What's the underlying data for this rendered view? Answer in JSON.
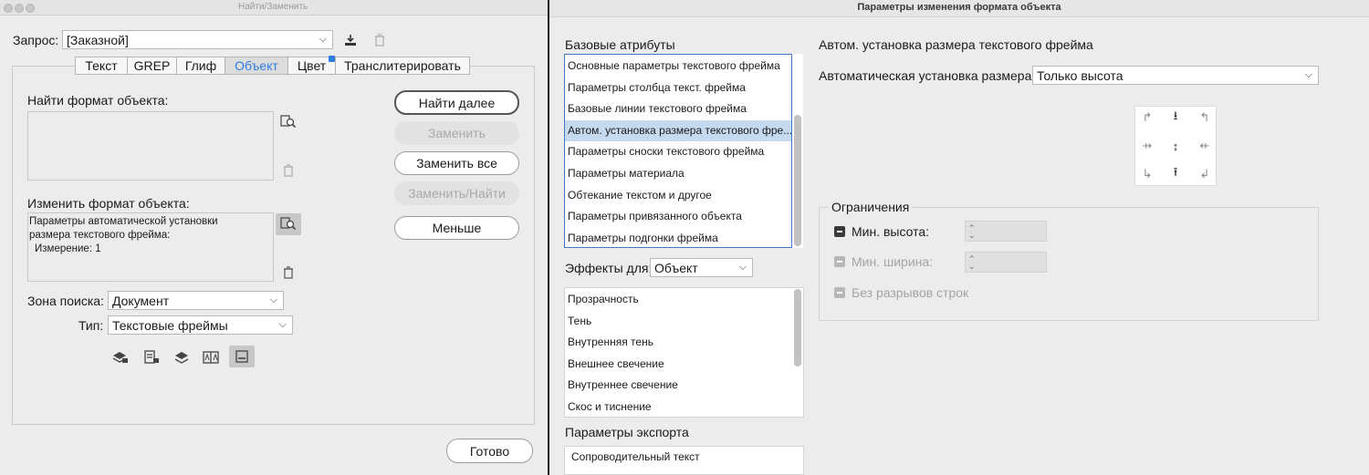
{
  "find_window": {
    "title": "Найти/Заменить",
    "query_label": "Запрос:",
    "query_value": "[Заказной]",
    "tabs": [
      {
        "label": "Текст"
      },
      {
        "label": "GREP"
      },
      {
        "label": "Глиф"
      },
      {
        "label": "Объект"
      },
      {
        "label": "Цвет"
      },
      {
        "label": "Транслитерировать"
      }
    ],
    "active_tab": "Объект",
    "find_format_label": "Найти формат объекта:",
    "change_format_label": "Изменить формат объекта:",
    "change_format_text_line1": "Параметры автоматической установки",
    "change_format_text_line2": "размера текстового фрейма:",
    "change_format_text_line3": "Измерение: 1",
    "buttons": {
      "find_next": "Найти далее",
      "replace": "Заменить",
      "replace_all": "Заменить все",
      "replace_find": "Заменить/Найти",
      "fewer": "Меньше",
      "done": "Готово"
    },
    "search_zone_label": "Зона поиска:",
    "search_zone_value": "Документ",
    "type_label": "Тип:",
    "type_value": "Текстовые фреймы",
    "accent_color": "#2f7de0"
  },
  "format_window": {
    "title": "Параметры изменения формата объекта",
    "basic_attributes_heading": "Базовые атрибуты",
    "basic_attributes": [
      "Основные параметры текстового фрейма",
      "Параметры столбца текст. фрейма",
      "Базовые линии текстового фрейма",
      "Автом. установка размера текстового фре...",
      "Параметры сноски текстового фрейма",
      "Параметры материала",
      "Обтекание текстом и другое",
      "Параметры привязанного объекта",
      "Параметры подгонки фрейма"
    ],
    "selected_index": 3,
    "effects_label": "Эффекты для:",
    "effects_value": "Объект",
    "effects": [
      "Прозрачность",
      "Тень",
      "Внутренняя тень",
      "Внешнее свечение",
      "Внутреннее свечение",
      "Скос и тиснение"
    ],
    "export_heading": "Параметры экспорта",
    "export_items": [
      "Сопроводительный текст"
    ],
    "panel_title": "Автом. установка размера текстового фрейма",
    "auto_size_label": "Автоматическая установка размера",
    "auto_size_value": "Только высота",
    "constraints_heading": "Ограничения",
    "min_height_label": "Мин. высота:",
    "min_width_label": "Мин. ширина:",
    "no_line_breaks_label": "Без разрывов строк",
    "selection_color": "#c5d9ef",
    "list_border_color": "#3d79c9"
  }
}
